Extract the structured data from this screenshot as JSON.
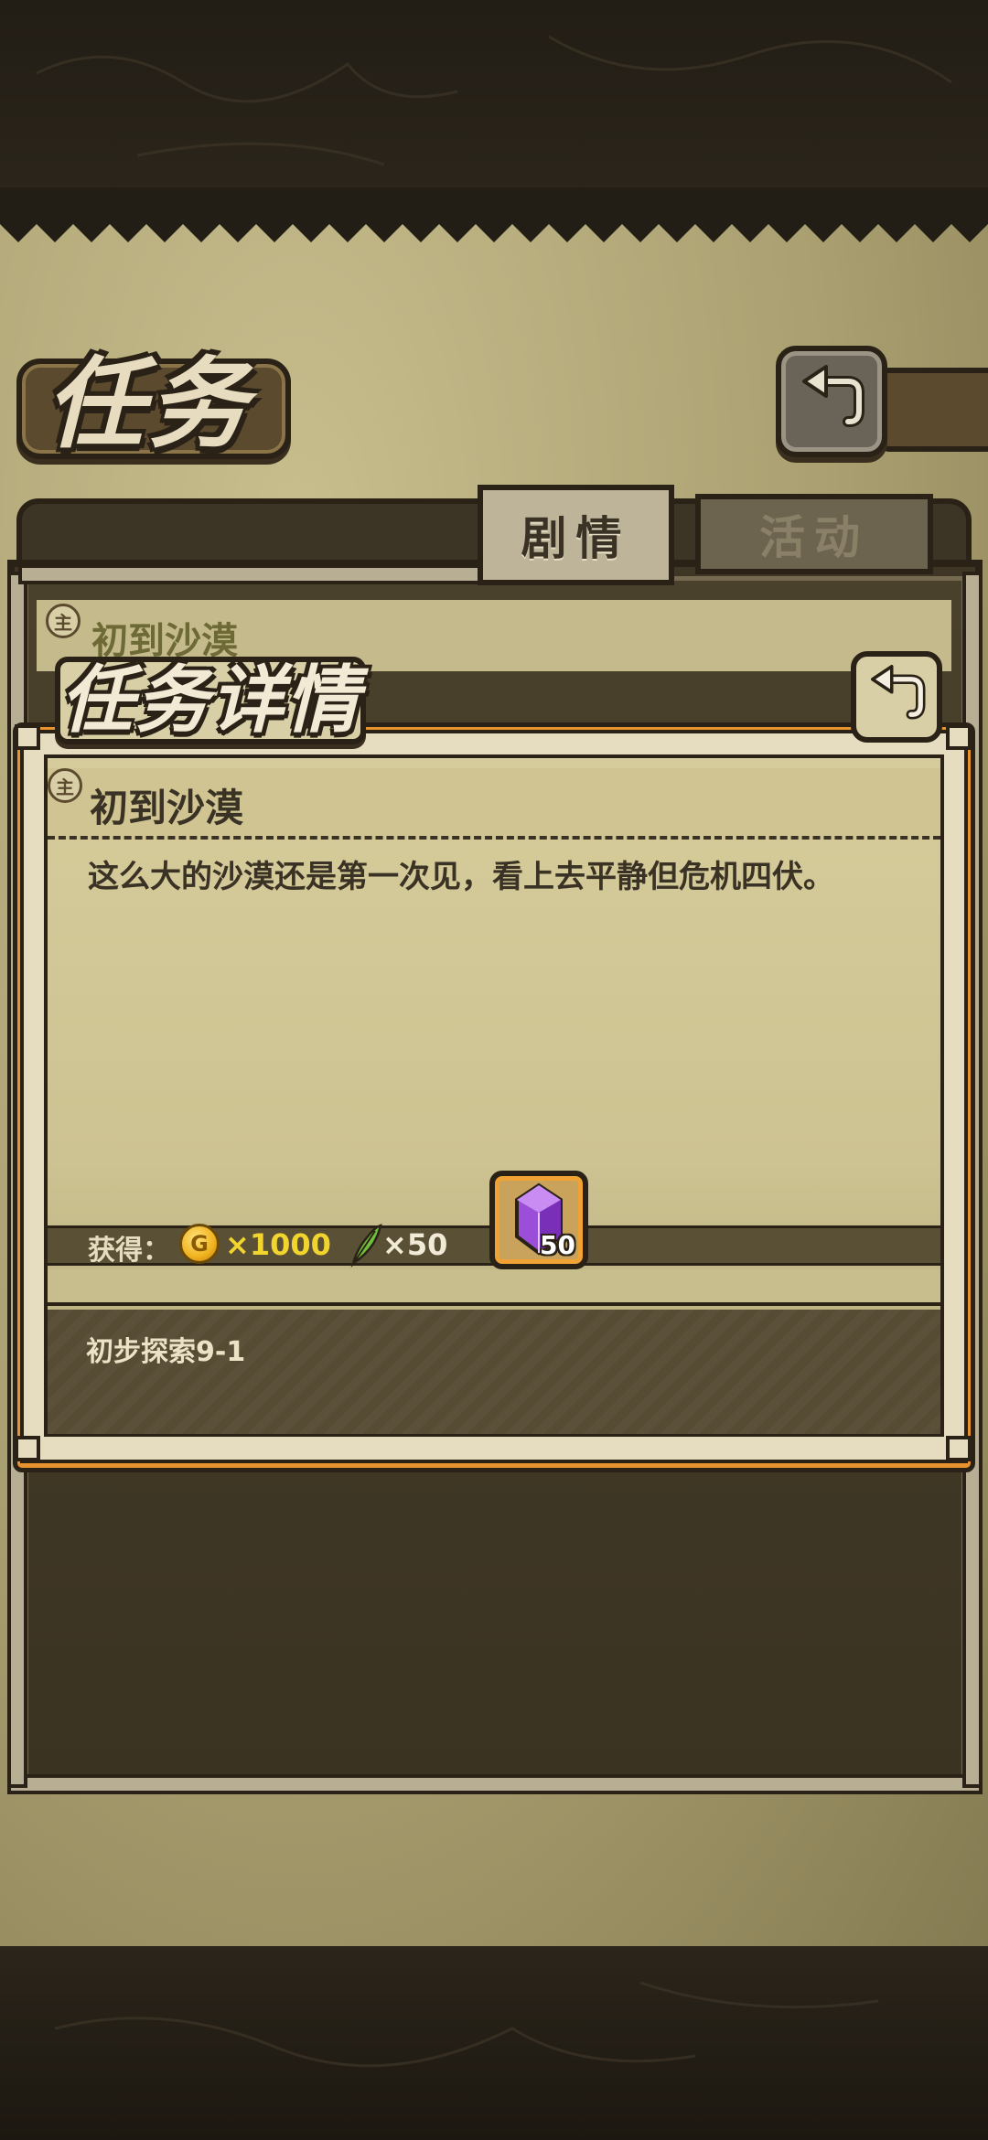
{
  "header": {
    "title": "任务",
    "back_icon": "return-arrow-icon"
  },
  "tabs": [
    {
      "label": "剧情",
      "active": true
    },
    {
      "label": "活动",
      "active": false
    }
  ],
  "list": {
    "item_title": "初到沙漠",
    "item_badge": "主"
  },
  "dialog": {
    "title": "任务详情",
    "close_icon": "return-arrow-icon",
    "quest_badge": "主",
    "quest_name": "初到沙漠",
    "description": "这么大的沙漠还是第一次见，看上去平静但危机四伏。",
    "reward_label": "获得：",
    "rewards": [
      {
        "icon": "gold-coin-icon",
        "glyph": "G",
        "amount": "×1000"
      },
      {
        "icon": "feather-icon",
        "amount": "×50"
      },
      {
        "icon": "purple-gem-icon",
        "amount": "50"
      }
    ],
    "stage": "初步探索9-1"
  },
  "colors": {
    "accent_orange": "#e8932e",
    "coin_text": "#f1d52e",
    "parchment": "#cfc492",
    "frame_dark": "#2a2216"
  }
}
